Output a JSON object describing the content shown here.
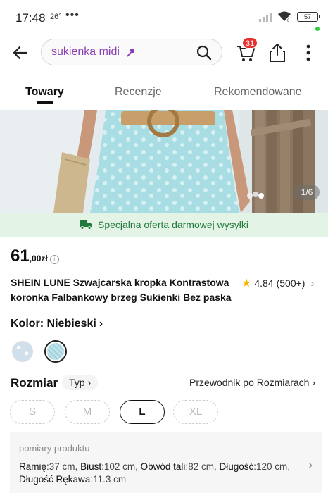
{
  "status_bar": {
    "time": "17:48",
    "temperature": "26°",
    "dots": "•••",
    "battery": "57"
  },
  "search": {
    "query": "sukienka midi"
  },
  "cart": {
    "badge": "31"
  },
  "tabs": [
    {
      "label": "Towary",
      "active": true
    },
    {
      "label": "Recenzje",
      "active": false
    },
    {
      "label": "Rekomendowane",
      "active": false
    }
  ],
  "gallery": {
    "counter": "1/6"
  },
  "shipping_banner": {
    "text": "Specjalna oferta darmowej wysyłki"
  },
  "product": {
    "price_main": "61",
    "price_cents": ",00zł",
    "price_info": "i",
    "title": "SHEIN LUNE Szwajcarska kropka Kontrastowa koronka Falbankowy brzeg Sukienki Bez paska",
    "rating": "4.84",
    "reviews": "(500+)"
  },
  "color": {
    "label": "Kolor: Niebieski",
    "swatches": [
      "white-dot",
      "light-blue"
    ]
  },
  "size": {
    "label": "Rozmiar",
    "type_button": "Typ",
    "guide": "Przewodnik po Rozmiarach",
    "options": [
      {
        "label": "S",
        "selected": false
      },
      {
        "label": "M",
        "selected": false
      },
      {
        "label": "L",
        "selected": true
      },
      {
        "label": "XL",
        "selected": false
      }
    ]
  },
  "measurements": {
    "heading": "pomiary produktu",
    "items": [
      {
        "name": "Ramię",
        "value": "37 cm"
      },
      {
        "name": "Biust",
        "value": "102 cm"
      },
      {
        "name": "Obwód tali",
        "value": "82 cm"
      },
      {
        "name": "Długość",
        "value": "120 cm"
      },
      {
        "name": "Długość Rękawa",
        "value": "11.3 cm"
      }
    ]
  },
  "colors": {
    "accent_purple": "#8c3fb4",
    "badge_red": "#e63131",
    "banner_green_bg": "#e3f4e6",
    "banner_green_text": "#227a3c",
    "star": "#f5b400"
  }
}
